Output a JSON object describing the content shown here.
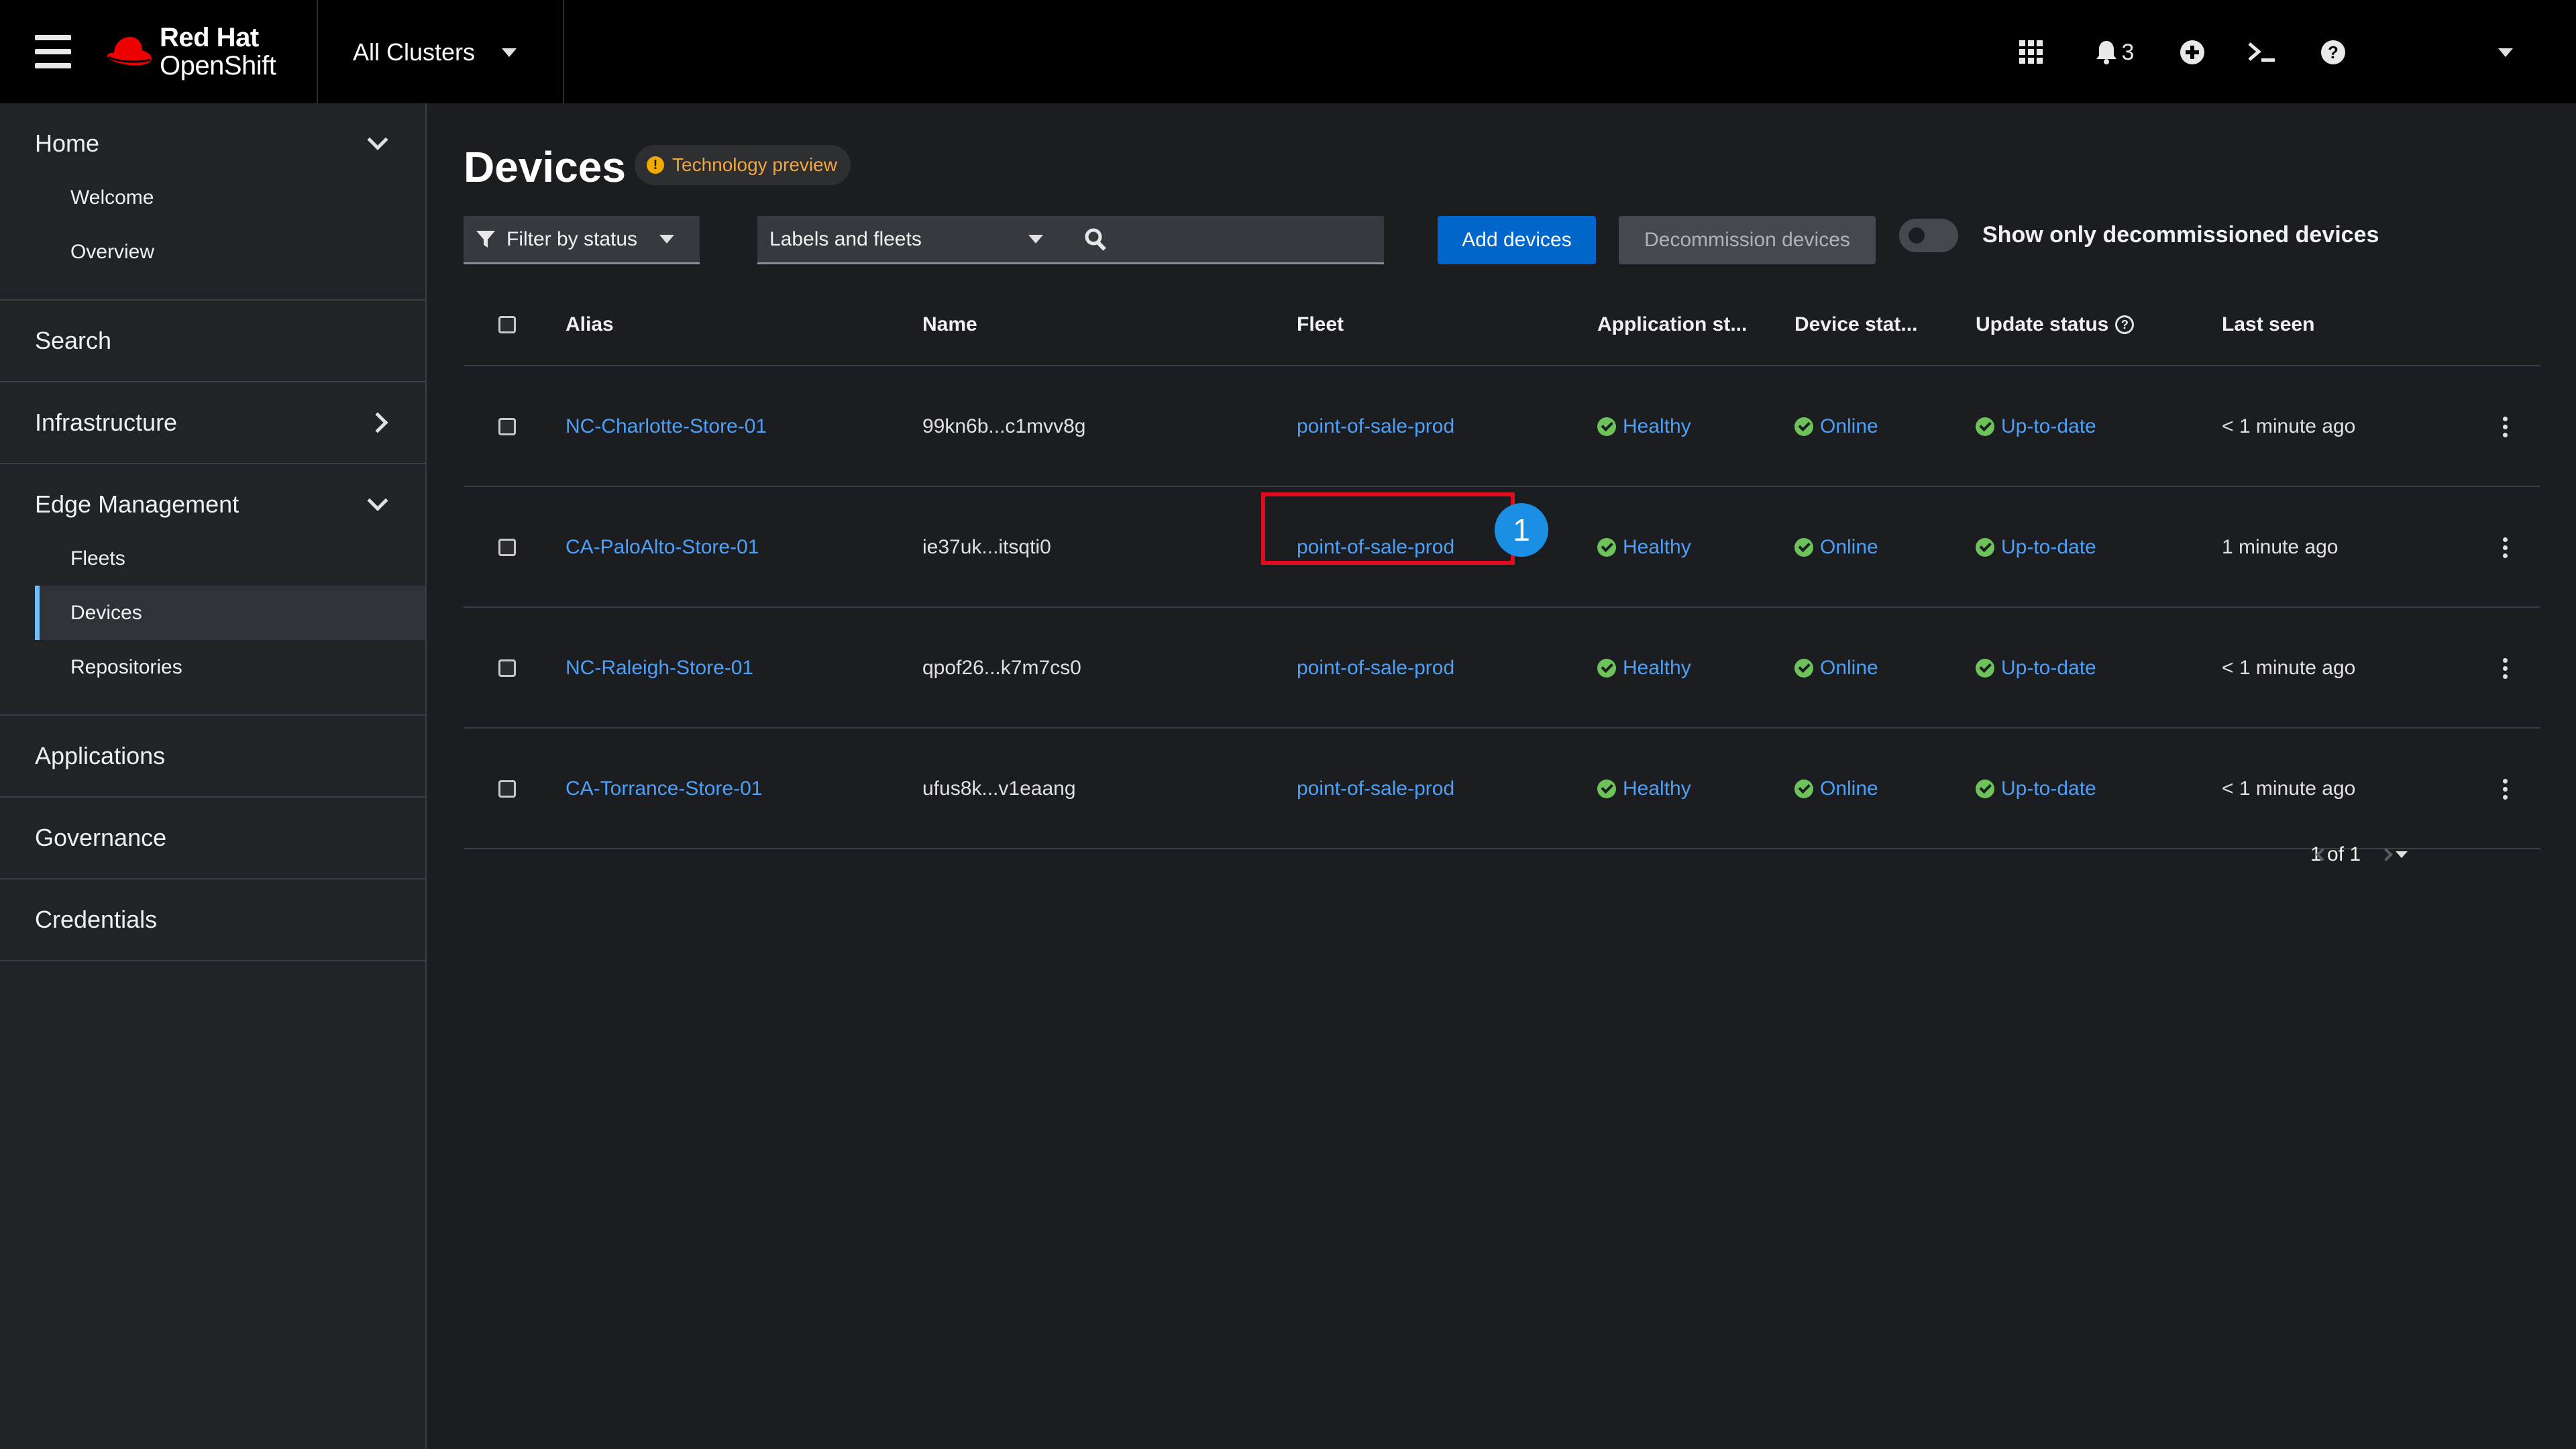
{
  "masthead": {
    "brand_line1": "Red Hat",
    "brand_line2": "OpenShift",
    "cluster_switcher": "All Clusters",
    "notification_count": "3",
    "icons": [
      "grid-icon",
      "bell-icon",
      "plus-circle-icon",
      "terminal-icon",
      "help-icon",
      "user-menu-caret"
    ]
  },
  "sidebar": {
    "groups": [
      {
        "label": "Home",
        "expanded": true,
        "items": [
          "Welcome",
          "Overview"
        ]
      },
      {
        "label": "Search"
      },
      {
        "label": "Infrastructure",
        "expanded": false
      },
      {
        "label": "Edge Management",
        "expanded": true,
        "items": [
          "Fleets",
          "Devices",
          "Repositories"
        ],
        "active": "Devices"
      },
      {
        "label": "Applications"
      },
      {
        "label": "Governance"
      },
      {
        "label": "Credentials"
      }
    ]
  },
  "page": {
    "title": "Devices",
    "badge": "Technology preview",
    "badge_icon": "!"
  },
  "toolbar": {
    "filter_status": "Filter by status",
    "labels_fleets": "Labels and fleets",
    "search_value": "",
    "add_devices": "Add devices",
    "decommission_devices": "Decommission devices",
    "toggle_label": "Show only decommissioned devices"
  },
  "table": {
    "headers": {
      "alias": "Alias",
      "name": "Name",
      "fleet": "Fleet",
      "app_status": "Application st...",
      "device_status": "Device stat...",
      "update_status": "Update status",
      "update_help": "?",
      "last_seen": "Last seen"
    },
    "rows": [
      {
        "alias": "NC-Charlotte-Store-01",
        "name": "99kn6b...c1mvv8g",
        "fleet": "point-of-sale-prod",
        "app": "Healthy",
        "device": "Online",
        "update": "Up-to-date",
        "last_seen": "< 1 minute ago"
      },
      {
        "alias": "CA-PaloAlto-Store-01",
        "name": "ie37uk...itsqti0",
        "fleet": "point-of-sale-prod",
        "app": "Healthy",
        "device": "Online",
        "update": "Up-to-date",
        "last_seen": "1 minute ago"
      },
      {
        "alias": "NC-Raleigh-Store-01",
        "name": "qpof26...k7m7cs0",
        "fleet": "point-of-sale-prod",
        "app": "Healthy",
        "device": "Online",
        "update": "Up-to-date",
        "last_seen": "< 1 minute ago"
      },
      {
        "alias": "CA-Torrance-Store-01",
        "name": "ufus8k...v1eaang",
        "fleet": "point-of-sale-prod",
        "app": "Healthy",
        "device": "Online",
        "update": "Up-to-date",
        "last_seen": "< 1 minute ago"
      }
    ]
  },
  "pagination": {
    "range": "1 of 1"
  },
  "annotation": {
    "callout_number": "1"
  },
  "colors": {
    "accent": "#0066cc",
    "link": "#4da0f5",
    "healthy": "#6dc35a",
    "highlight": "#e00b1c",
    "callout": "#1a8fe3"
  }
}
